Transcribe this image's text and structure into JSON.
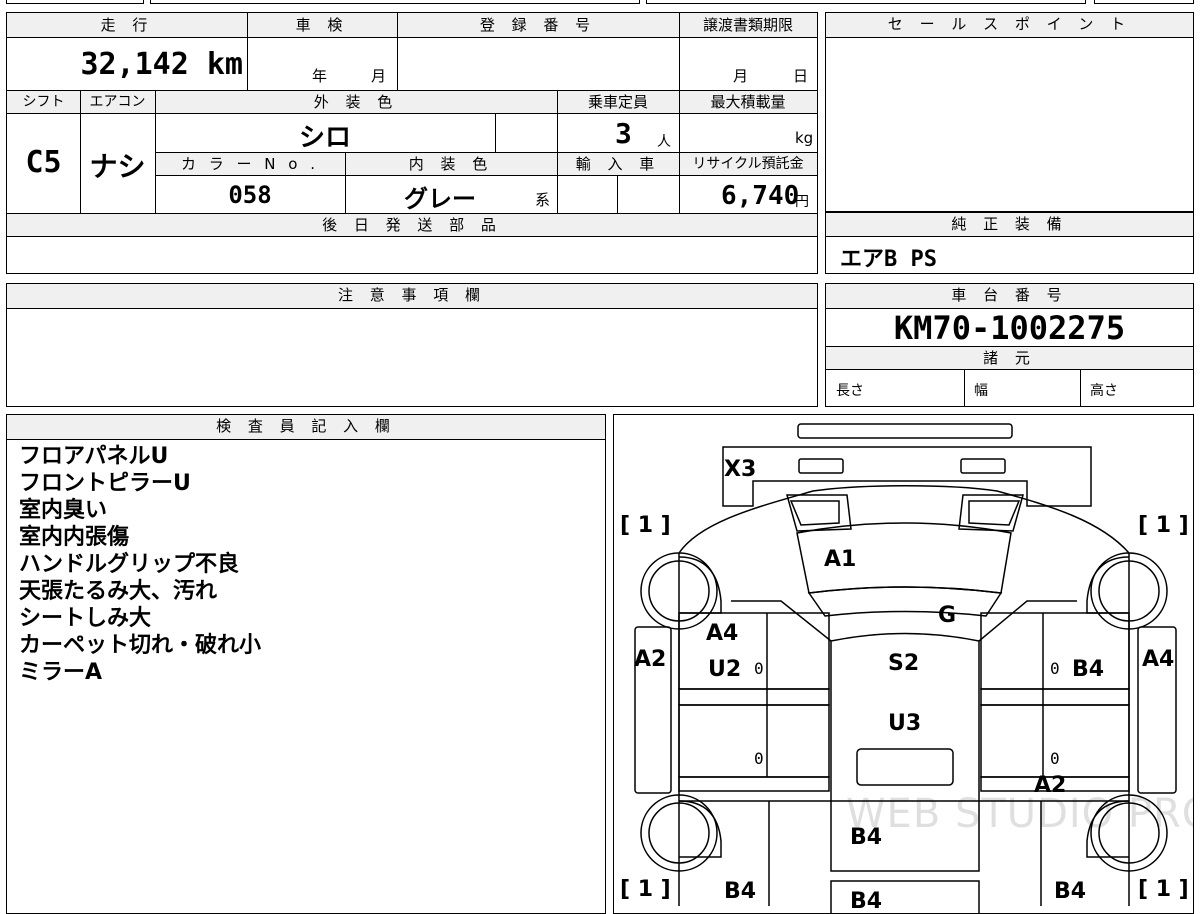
{
  "specs": {
    "mileage_label": "走 行",
    "mileage_value": "32,142 km",
    "inspection_label": "車 検",
    "inspection_year": "年",
    "inspection_month": "月",
    "registration_label": "登 録 番 号",
    "transfer_label": "譲渡書類期限",
    "transfer_month": "月",
    "transfer_day": "日",
    "shift_label": "シフト",
    "shift_value": "C5",
    "ac_label": "エアコン",
    "ac_value": "ナシ",
    "exterior_color_label": "外 装 色",
    "exterior_color_value": "シロ",
    "capacity_label": "乗車定員",
    "capacity_value": "3",
    "capacity_unit": "人",
    "max_load_label": "最大積載量",
    "max_load_unit": "kg",
    "color_no_label": "カ ラ ー N o .",
    "color_no_value": "058",
    "interior_color_label": "内 装 色",
    "interior_color_value": "グレー",
    "interior_color_suffix": "系",
    "import_label": "輸 入 車",
    "recycle_label": "リサイクル預託金",
    "recycle_value": "6,740",
    "recycle_unit": "円",
    "later_parts_label": "後 日 発 送 部 品"
  },
  "sales_point_label": "セ ー ル ス ポ イ ン ト",
  "genuine_equipment": {
    "label": "純 正 装 備",
    "value": "エアB PS"
  },
  "notes_label": "注 意 事 項 欄",
  "chassis": {
    "label": "車 台 番 号",
    "value": "KM70-1002275",
    "dims_label": "諸 元",
    "length_label": "長さ",
    "width_label": "幅",
    "height_label": "高さ"
  },
  "inspector": {
    "label": "検 査 員 記 入 欄",
    "lines": [
      "フロアパネルU",
      "フロントピラーU",
      "室内臭い",
      "室内内張傷",
      "ハンドルグリップ不良",
      "天張たるみ大、汚れ",
      "シートしみ大",
      "カーペット切れ・破れ小",
      "ミラーA"
    ]
  },
  "diagram": {
    "x3": "X3",
    "a1": "A1",
    "g": "G",
    "a4_left": "A4",
    "u2": "U2",
    "s2": "S2",
    "b4_right": "B4",
    "a2_left": "A2",
    "a4_right": "A4",
    "u3": "U3",
    "a2_bottom": "A2",
    "b4_center": "B4",
    "b4_bottom_left": "B4",
    "b4_bottom_center": "B4",
    "b4_bottom_right": "B4",
    "corner_tl": "[ 1 ]",
    "corner_tr": "[ 1 ]",
    "corner_bl": "[ 1 ]",
    "corner_br": "[ 1 ]",
    "zero": "0",
    "watermark": "WEB STUDIO PRO"
  }
}
